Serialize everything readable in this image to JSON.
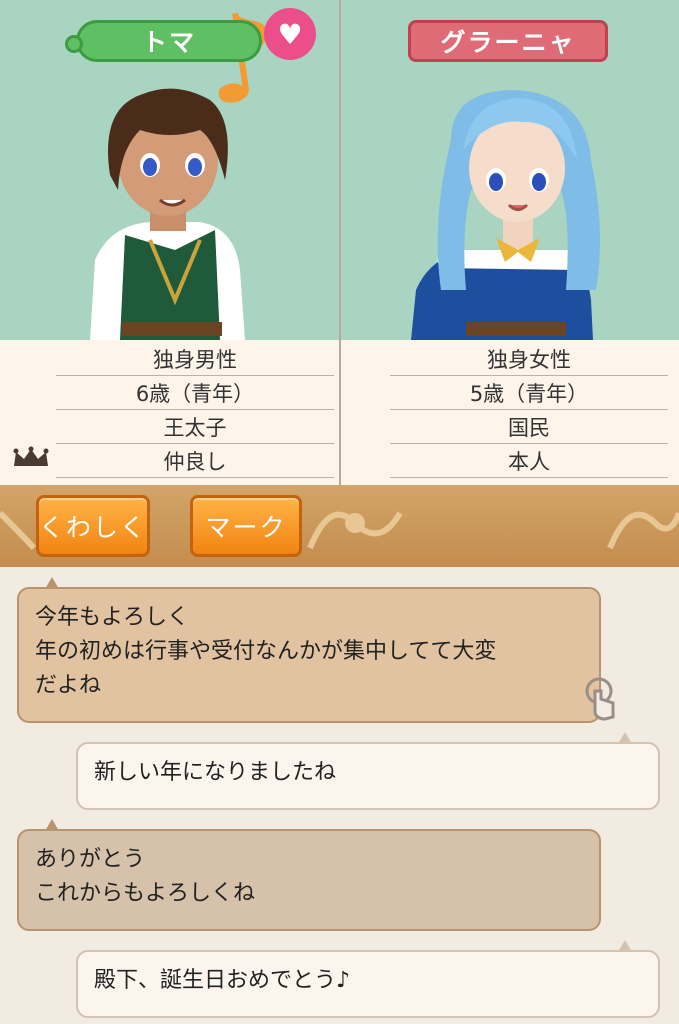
{
  "left_character": {
    "name": "トマ",
    "status": "独身男性",
    "age": "6歳（青年）",
    "title": "王太子",
    "relation": "仲良し"
  },
  "right_character": {
    "name": "グラーニャ",
    "status": "独身女性",
    "age": "5歳（青年）",
    "title": "国民",
    "relation": "本人"
  },
  "buttons": {
    "detail": "くわしく",
    "mark": "マーク"
  },
  "conversation": [
    {
      "side": "left",
      "lines": [
        "今年もよろしく",
        "年の初めは行事や受付なんかが集中してて大変",
        "だよね"
      ]
    },
    {
      "side": "right",
      "lines": [
        "新しい年になりましたね"
      ]
    },
    {
      "side": "left",
      "lines": [
        "ありがとう",
        "これからもよろしくね"
      ]
    },
    {
      "side": "right",
      "lines": [
        "殿下、誕生日おめでとう♪"
      ]
    }
  ],
  "icons": {
    "heart": "heart-icon",
    "music_note": "music-note-icon",
    "crown": "crown-icon",
    "tap": "tap-hand-icon"
  },
  "colors": {
    "male_name_bg": "#5fbf63",
    "female_name_bg": "#df6b76",
    "button_orange": "#f18411",
    "portrait_bg": "#a9d4c2"
  }
}
